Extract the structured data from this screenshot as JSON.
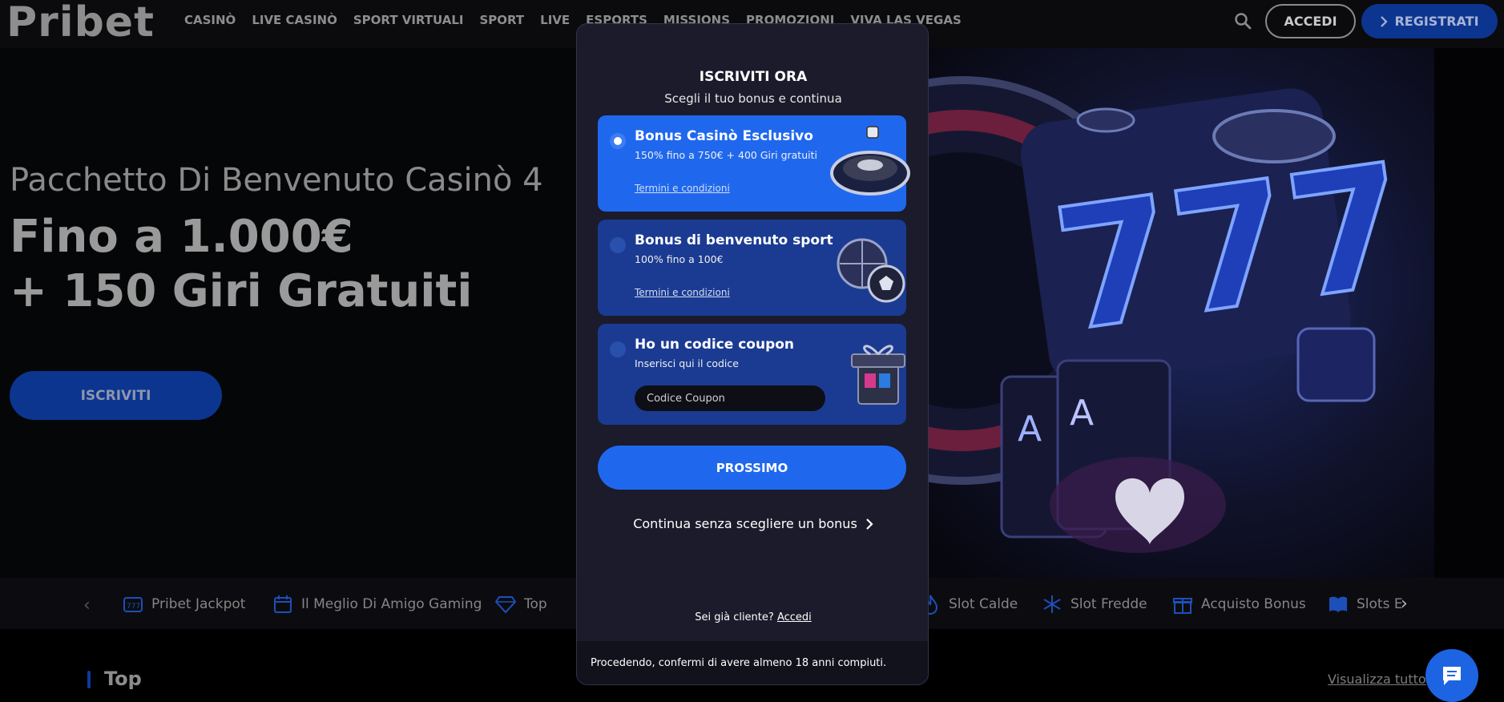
{
  "header": {
    "logo": "Pribet",
    "nav": [
      "CASINÒ",
      "LIVE CASINÒ",
      "SPORT VIRTUALI",
      "SPORT",
      "LIVE",
      "ESPORTS",
      "MISSIONS",
      "PROMOZIONI",
      "VIVA LAS VEGAS"
    ],
    "login_label": "ACCEDI",
    "register_label": "REGISTRATI",
    "icons": [
      "search-icon",
      "chevron-right-icon"
    ]
  },
  "hero": {
    "subtitle": "Pacchetto Di Benvenuto Casinò 4",
    "title_line1": "Fino a 1.000€",
    "title_line2": "+ 150 Giri Gratuiti",
    "cta_label": "ISCRIVITI"
  },
  "categories": [
    {
      "label": "Pribet Jackpot",
      "icon": "jackpot-icon"
    },
    {
      "label": "Il Meglio Di Amigo Gaming",
      "icon": "calendar-icon"
    },
    {
      "label": "Top",
      "icon": "diamond-icon"
    },
    {
      "label": "Slot Calde",
      "icon": "flame-icon"
    },
    {
      "label": "Slot Fredde",
      "icon": "snowflake-icon"
    },
    {
      "label": "Acquisto Bonus",
      "icon": "gift-icon"
    },
    {
      "label": "Slots E",
      "icon": "book-icon"
    }
  ],
  "section": {
    "title": "Top",
    "view_all_label": "Visualizza tutto"
  },
  "modal": {
    "title": "ISCRIVITI ORA",
    "subtitle": "Scegli il tuo bonus e continua",
    "options": [
      {
        "title": "Bonus Casinò Esclusivo",
        "desc": "150% fino a 750€ + 400 Giri gratuiti",
        "link": "Termini e condizioni",
        "selected": true
      },
      {
        "title": "Bonus di benvenuto sport",
        "desc": "100% fino a 100€",
        "link": "Termini e condizioni",
        "selected": false
      },
      {
        "title": "Ho un codice coupon",
        "desc": "Inserisci qui il codice",
        "placeholder": "Codice Coupon",
        "selected": false
      }
    ],
    "next_label": "PROSSIMO",
    "skip_label": "Continua senza scegliere un bonus",
    "already_client": "Sei già cliente?",
    "login_link": "Accedi",
    "footer_note": "Procedendo, confermi di avere almeno 18 anni compiuti."
  },
  "colors": {
    "accent": "#1f68ee",
    "modal_bg": "#1b1b2b",
    "option_inactive": "#1b3b92",
    "dimmed_accent": "#0c3590"
  }
}
